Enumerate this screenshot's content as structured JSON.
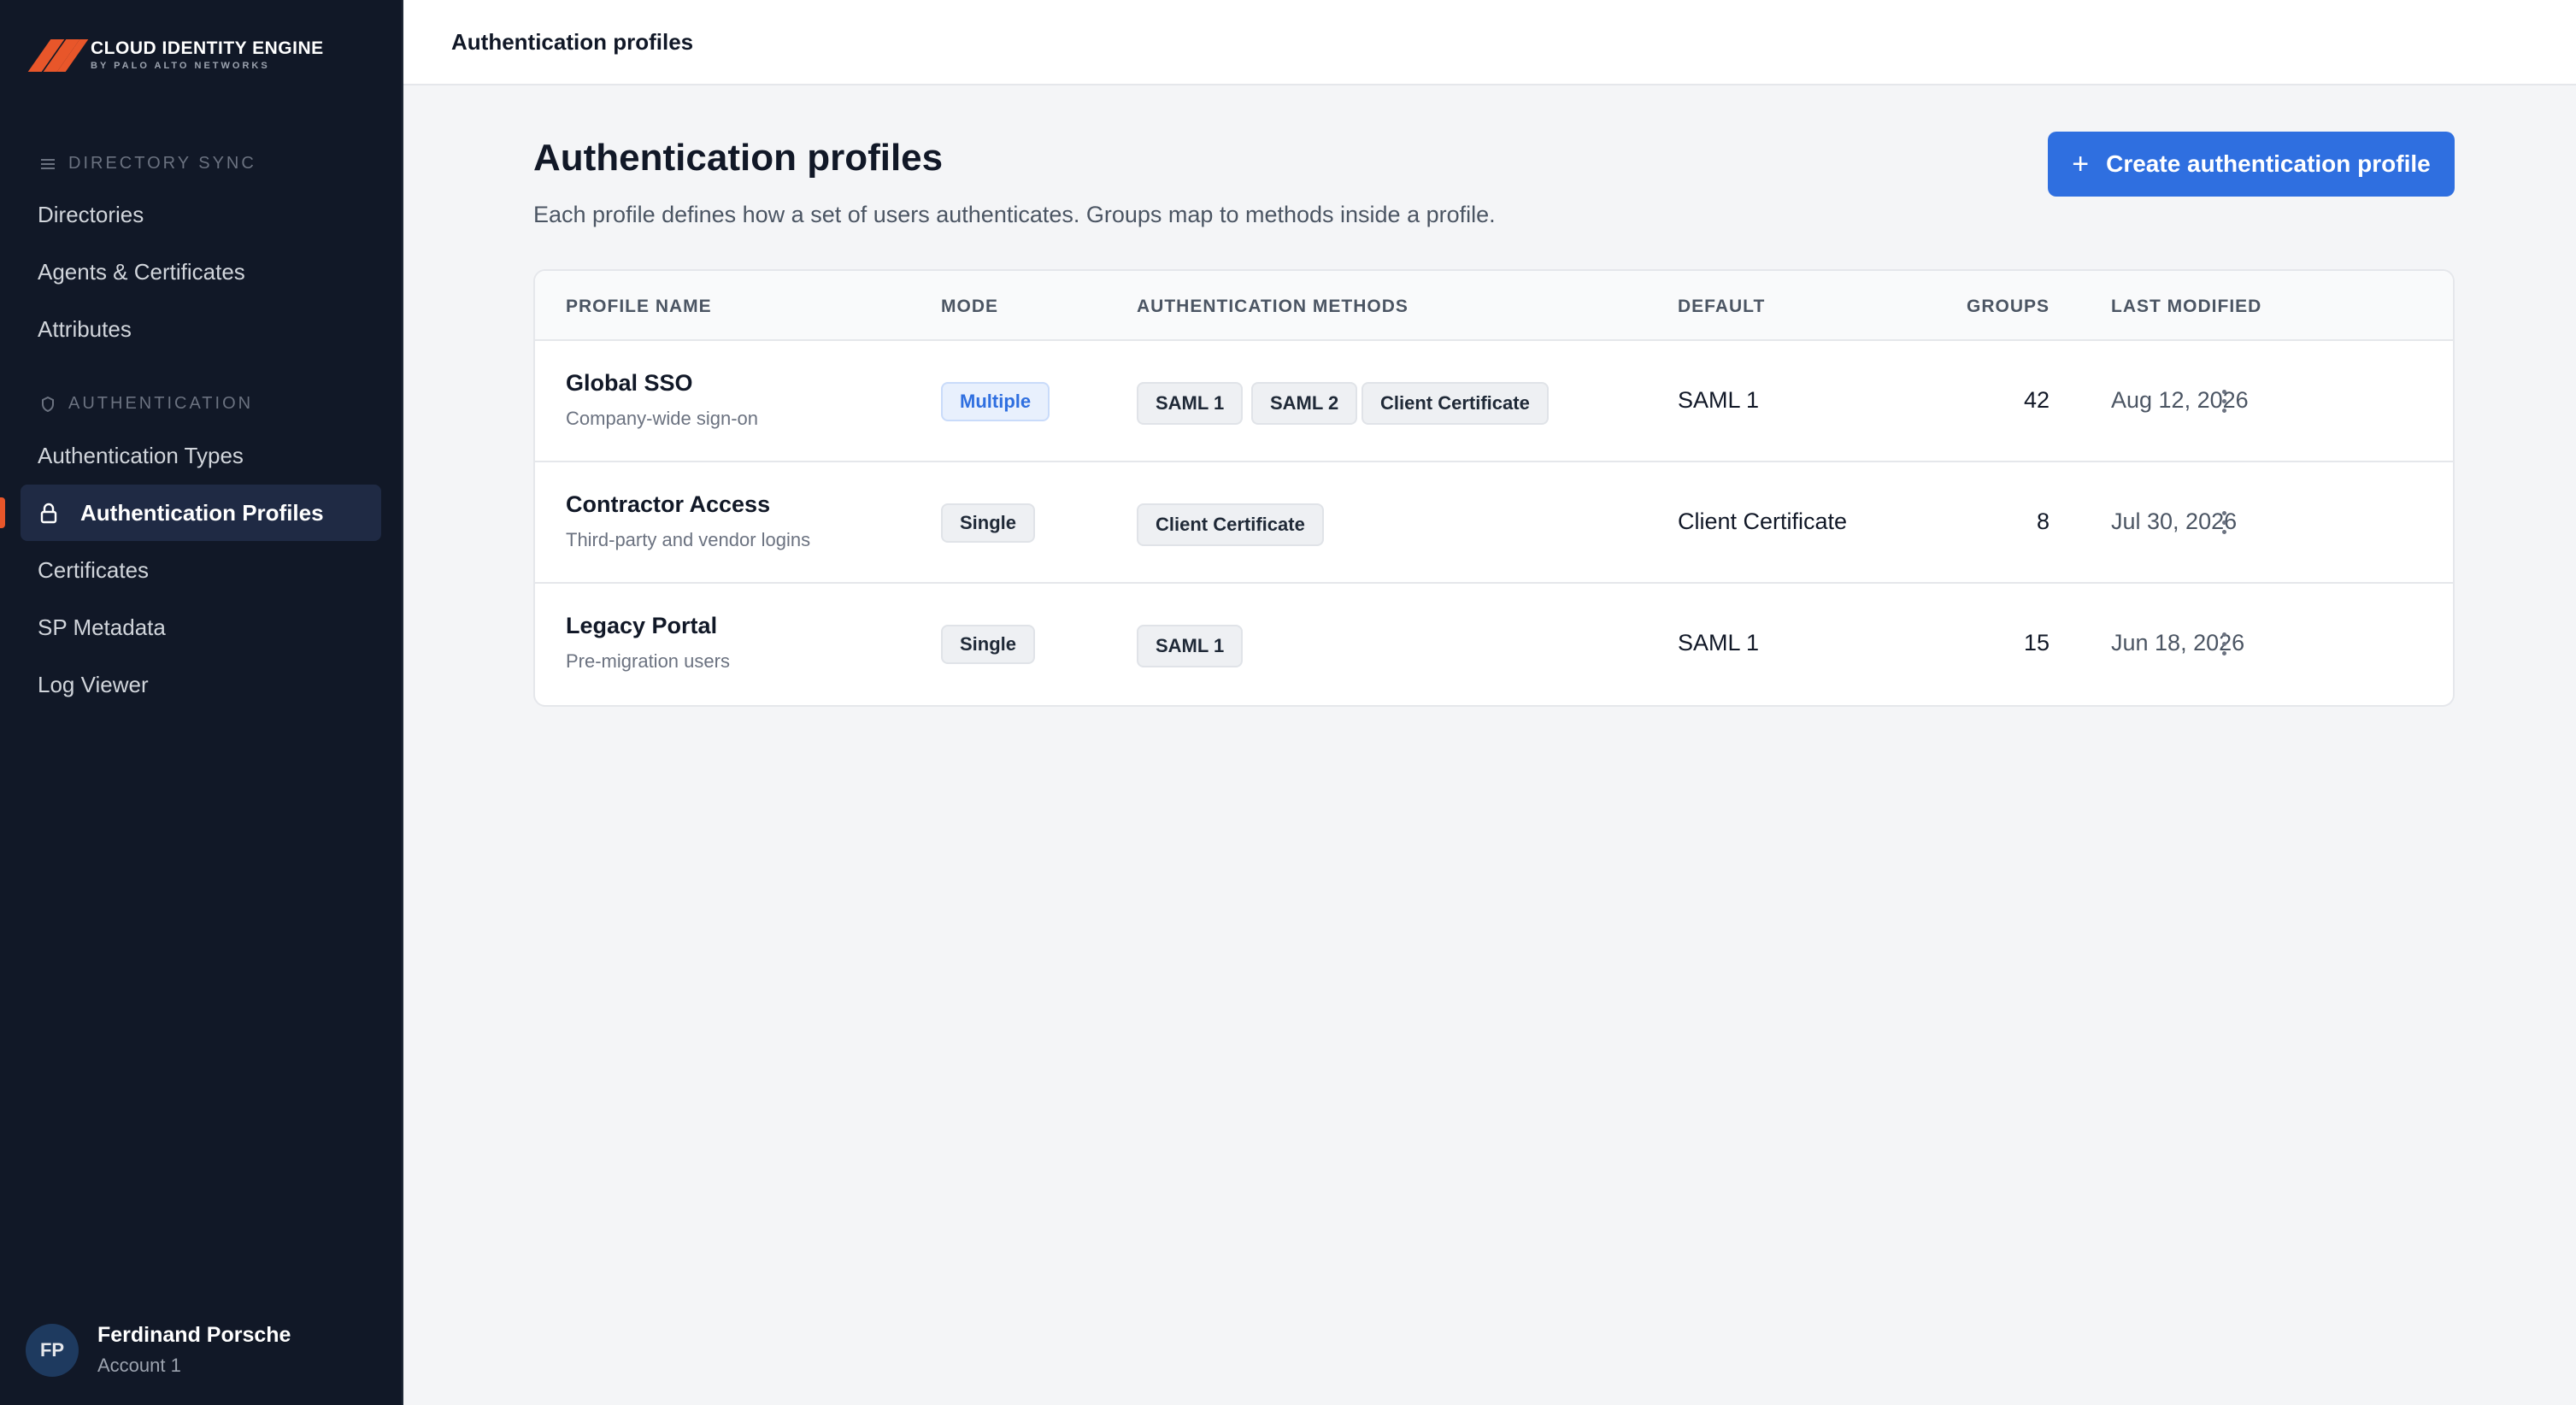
{
  "brand": {
    "title": "CLOUD IDENTITY ENGINE",
    "subtitle": "BY PALO ALTO NETWORKS",
    "accent": "#e8562a"
  },
  "sidebar": {
    "sections": [
      {
        "label": "DIRECTORY SYNC",
        "icon": "menu-icon"
      },
      {
        "label": "AUTHENTICATION",
        "icon": "shield-icon"
      }
    ],
    "items": [
      {
        "label": "Directories"
      },
      {
        "label": "Agents & Certificates"
      },
      {
        "label": "Attributes"
      },
      {
        "label": "Authentication Types"
      },
      {
        "label": "Authentication Profiles",
        "active": true,
        "icon": "lock-icon"
      },
      {
        "label": "Certificates"
      },
      {
        "label": "SP Metadata"
      },
      {
        "label": "Log Viewer"
      }
    ],
    "user": {
      "initials": "FP",
      "name": "Ferdinand Porsche",
      "account": "Account 1"
    }
  },
  "topbar": {
    "title": "Authentication profiles"
  },
  "main": {
    "title": "Authentication profiles",
    "subtitle": "Each profile defines how a set of users authenticates. Groups map to methods inside a profile.",
    "create_button": "Create authentication profile",
    "create_color": "#2f6fe0"
  },
  "table": {
    "columns": [
      "PROFILE NAME",
      "MODE",
      "AUTHENTICATION METHODS",
      "DEFAULT",
      "GROUPS",
      "LAST MODIFIED"
    ],
    "rows": [
      {
        "name": "Global SSO",
        "description": "Company-wide sign-on",
        "mode": "Multiple",
        "methods": [
          "SAML 1",
          "SAML 2",
          "Client Certificate"
        ],
        "default": "SAML 1",
        "groups": "42",
        "last_modified": "Aug 12, 2026"
      },
      {
        "name": "Contractor Access",
        "description": "Third-party and vendor logins",
        "mode": "Single",
        "methods": [
          "Client Certificate"
        ],
        "default": "Client Certificate",
        "groups": "8",
        "last_modified": "Jul 30, 2026"
      },
      {
        "name": "Legacy Portal",
        "description": "Pre-migration users",
        "mode": "Single",
        "methods": [
          "SAML 1"
        ],
        "default": "SAML 1",
        "groups": "15",
        "last_modified": "Jun 18, 2026"
      }
    ]
  }
}
